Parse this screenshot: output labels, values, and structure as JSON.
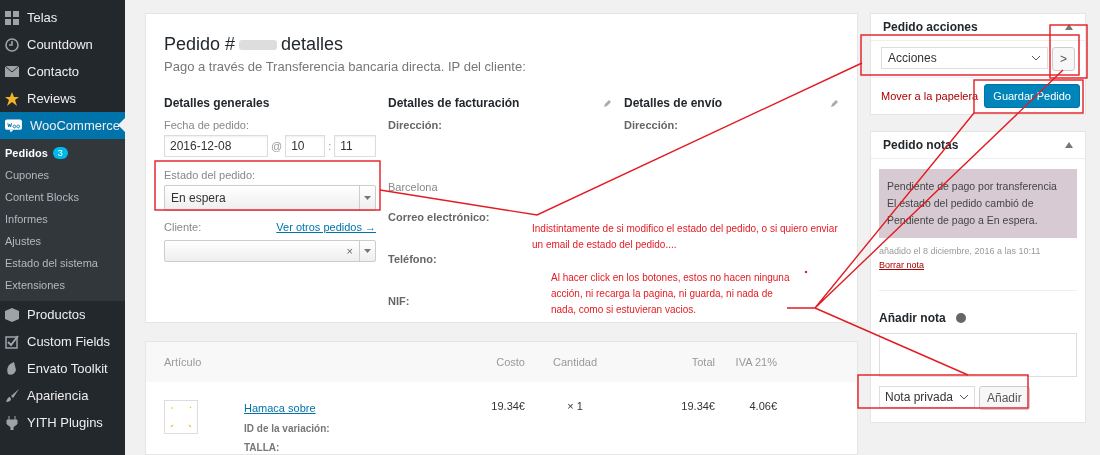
{
  "sidebar": {
    "items": [
      {
        "label": "Telas",
        "selected": false
      },
      {
        "label": "Countdown",
        "selected": false
      },
      {
        "label": "Contacto",
        "selected": false
      },
      {
        "label": "Reviews",
        "selected": false
      },
      {
        "label": "WooCommerce",
        "selected": true,
        "children": [
          {
            "label": "Pedidos",
            "selected": true,
            "badge": "3"
          },
          {
            "label": "Cupones",
            "selected": false
          },
          {
            "label": "Content Blocks",
            "selected": false
          },
          {
            "label": "Informes",
            "selected": false
          },
          {
            "label": "Ajustes",
            "selected": false
          },
          {
            "label": "Estado del sistema",
            "selected": false
          },
          {
            "label": "Extensiones",
            "selected": false
          }
        ]
      },
      {
        "label": "Productos",
        "selected": false
      },
      {
        "label": "Custom Fields",
        "selected": false
      },
      {
        "label": "Envato Toolkit",
        "selected": false
      },
      {
        "label": "Apariencia",
        "selected": false
      },
      {
        "label": "YITH Plugins",
        "selected": false
      }
    ]
  },
  "order": {
    "title_start": "Pedido #",
    "title_end": "detalles",
    "subtitle": "Pago a través de Transferencia bancaria directa. IP del cliente:",
    "general": {
      "heading": "Detalles generales",
      "date_label": "Fecha de pedido:",
      "date": "2016-12-08",
      "at": "@",
      "hour": "10",
      "colon": ":",
      "minute": "11",
      "status_label": "Estado del pedido:",
      "status": "En espera",
      "customer_label": "Cliente:",
      "customer_link": "Ver otros pedidos →",
      "clear": "×"
    },
    "billing": {
      "heading": "Detalles de facturación",
      "fields": [
        {
          "label": "Dirección:",
          "value": "Barcelona"
        },
        {
          "label": "Correo electrónico:"
        },
        {
          "label": "Teléfono:"
        },
        {
          "label": "NIF:"
        }
      ]
    },
    "shipping": {
      "heading": "Detalles de envío",
      "fields": [
        {
          "label": "Dirección:"
        }
      ]
    }
  },
  "items": {
    "columns": [
      "Artículo",
      "Costo",
      "Cantidad",
      "Total",
      "IVA 21%"
    ],
    "rows": [
      {
        "name": "Hamaca sobre",
        "cost": "19.34€",
        "quantity": "× 1",
        "total": "19.34€",
        "tax": "4.06€",
        "meta": [
          "ID de la variación:",
          "TALLA:"
        ]
      }
    ]
  },
  "actions": {
    "title": "Pedido acciones",
    "select": "Acciones",
    "apply": ">",
    "trash": "Mover a la papelera",
    "save": "Guardar Pedido"
  },
  "notes": {
    "title": "Pedido notas",
    "list": [
      {
        "text": "Pendiente de pago por transferencia El estado del pedido cambió de Pendiente de pago a En espera.",
        "meta": "añadido el 8 diciembre, 2016 a las 10:11",
        "delete": "Borrar nota"
      }
    ],
    "add_label": "Añadir nota",
    "type": "Nota privada",
    "add_button": "Añadir"
  },
  "annotations": [
    {
      "text": "Indistintamente de si modifico el estado del pedido, o si quiero enviar un email de estado del pedido...."
    },
    {
      "text": "Al hacer click en los botones, estos no hacen ninguna acción, ni recarga la pagina, ni guarda, ni nada de nada, como si estuvieran vacios."
    }
  ]
}
